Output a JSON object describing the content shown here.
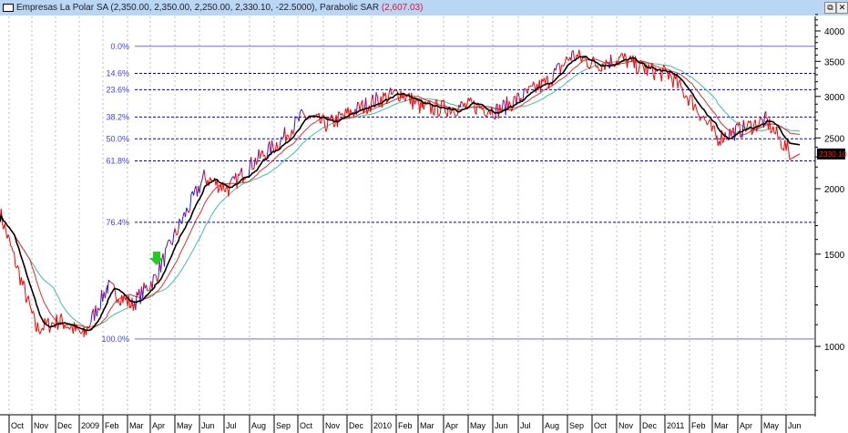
{
  "header": {
    "symbol": "Empresas La Polar SA",
    "ohlc": "(2,350.00, 2,350.00, 2,250.00, 2,330.10, -22.5000),",
    "indicator": "Parabolic SAR",
    "indicator_value": "(2,607.03)"
  },
  "window_buttons": {
    "restore": "⧉",
    "close": "✕"
  },
  "colors": {
    "up": "#1a1aff",
    "down": "#ff0000",
    "ma_fast": "#000000",
    "ma_mid": "#e03030",
    "ma_slow": "#40c0a0",
    "fib": "#0000e0",
    "arrow": "#22cc22"
  },
  "chart_data": {
    "type": "line",
    "title": "Empresas La Polar SA",
    "yscale": "log",
    "ylim": [
      780,
      4350
    ],
    "yticks": [
      1000,
      1500,
      2000,
      2500,
      3000,
      3500,
      4000
    ],
    "xticks": [
      "Oct",
      "Nov",
      "Dec",
      "2009",
      "Feb",
      "Mar",
      "Apr",
      "May",
      "Jun",
      "Jul",
      "Aug",
      "Sep",
      "Oct",
      "Nov",
      "Dec",
      "2010",
      "Feb",
      "Mar",
      "Apr",
      "May",
      "Jun",
      "Jul",
      "Aug",
      "Sep",
      "Oct",
      "Nov",
      "Dec",
      "2011",
      "Feb",
      "Mar",
      "Apr",
      "May",
      "Jun"
    ],
    "price_monthly": [
      1800,
      1080,
      1120,
      1050,
      1300,
      1200,
      1350,
      1700,
      2100,
      2000,
      2250,
      2450,
      2750,
      2650,
      2800,
      2950,
      3050,
      2850,
      2850,
      2880,
      2820,
      3000,
      3200,
      3600,
      3450,
      3550,
      3380,
      3300,
      2900,
      2500,
      2600,
      2700,
      2330
    ],
    "last_price": "2330.10",
    "fib_levels": [
      {
        "label": "0.0%",
        "value": 3740
      },
      {
        "label": "14.6%",
        "value": 3320
      },
      {
        "label": "23.6%",
        "value": 3090
      },
      {
        "label": "38.2%",
        "value": 2740
      },
      {
        "label": "50.0%",
        "value": 2490
      },
      {
        "label": "61.8%",
        "value": 2260
      },
      {
        "label": "76.4%",
        "value": 1725
      },
      {
        "label": "100.0%",
        "value": 1033
      }
    ],
    "signal": {
      "type": "buy-arrow",
      "month": "Apr 2009"
    },
    "grid": true
  }
}
